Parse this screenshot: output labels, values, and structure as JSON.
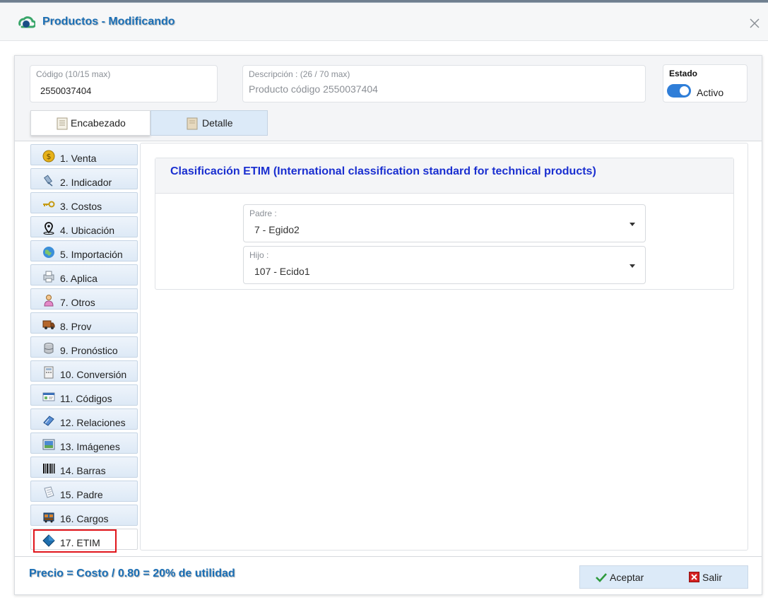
{
  "window": {
    "title": "Productos - Modificando"
  },
  "codigo": {
    "label": "Código (10/15 max)",
    "value": "2550037404"
  },
  "descripcion": {
    "label": "Descripción : (26 / 70 max)",
    "placeholder": "Producto código 2550037404"
  },
  "estado": {
    "label": "Estado",
    "value": "Activo",
    "on": true
  },
  "tabs": [
    {
      "label": "Encabezado",
      "active": true
    },
    {
      "label": "Detalle",
      "active": false
    }
  ],
  "sidebar": {
    "items": [
      {
        "label": "1. Venta",
        "icon": "coin-icon"
      },
      {
        "label": "2. Indicador",
        "icon": "satellite-icon"
      },
      {
        "label": "3. Costos",
        "icon": "key-icon"
      },
      {
        "label": "4. Ubicación",
        "icon": "location-pin-icon"
      },
      {
        "label": "5. Importación",
        "icon": "globe-icon"
      },
      {
        "label": "6. Aplica",
        "icon": "printer-icon"
      },
      {
        "label": "7. Otros",
        "icon": "person-icon"
      },
      {
        "label": "8. Prov",
        "icon": "truck-icon"
      },
      {
        "label": "9. Pronóstico",
        "icon": "database-icon"
      },
      {
        "label": "10. Conversión",
        "icon": "calculator-icon"
      },
      {
        "label": "11. Códigos",
        "icon": "id-card-icon"
      },
      {
        "label": "12. Relaciones",
        "icon": "book-icon"
      },
      {
        "label": "13. Imágenes",
        "icon": "image-icon"
      },
      {
        "label": "14. Barras",
        "icon": "barcode-icon"
      },
      {
        "label": "15. Padre",
        "icon": "document-icon"
      },
      {
        "label": "16. Cargos",
        "icon": "cargo-icon"
      },
      {
        "label": "17. ETIM",
        "icon": "diamond-icon",
        "active": true
      }
    ]
  },
  "etim": {
    "title": "Clasificación ETIM (International classification standard for technical products)",
    "padre": {
      "label": "Padre :",
      "value": "7 - Egido2"
    },
    "hijo": {
      "label": "Hijo :",
      "value": "107 - Ecido1"
    }
  },
  "footer": {
    "note": "Precio = Costo / 0.80 = 20% de utilidad",
    "accept_label": "Aceptar",
    "exit_label": "Salir"
  },
  "colors": {
    "title_blue": "#1b6fb5",
    "etim_title": "#1a2fd0",
    "highlight_red": "#e0151b",
    "toggle_on": "#2f7ed8"
  }
}
